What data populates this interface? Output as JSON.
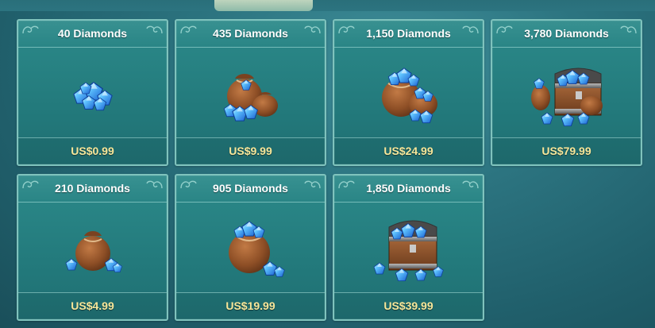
{
  "colors": {
    "title_text": "#ffffff",
    "price_text": "#f7e79a",
    "card_border": "#7fc3bd",
    "card_fill": "#2c8a8a",
    "background": "#2c7480"
  },
  "packages": [
    {
      "title": "40 Diamonds",
      "price": "US$0.99",
      "icon": "diamond-pile-small-icon"
    },
    {
      "title": "435 Diamonds",
      "price": "US$9.99",
      "icon": "diamond-sack-pair-icon"
    },
    {
      "title": "1,150 Diamonds",
      "price": "US$24.99",
      "icon": "diamond-sacks-large-icon"
    },
    {
      "title": "3,780 Diamonds",
      "price": "US$79.99",
      "icon": "diamond-chest-large-icon"
    },
    {
      "title": "210 Diamonds",
      "price": "US$4.99",
      "icon": "diamond-sack-small-icon"
    },
    {
      "title": "905 Diamonds",
      "price": "US$19.99",
      "icon": "diamond-sack-full-icon"
    },
    {
      "title": "1,850 Diamonds",
      "price": "US$39.99",
      "icon": "diamond-chest-icon"
    }
  ]
}
